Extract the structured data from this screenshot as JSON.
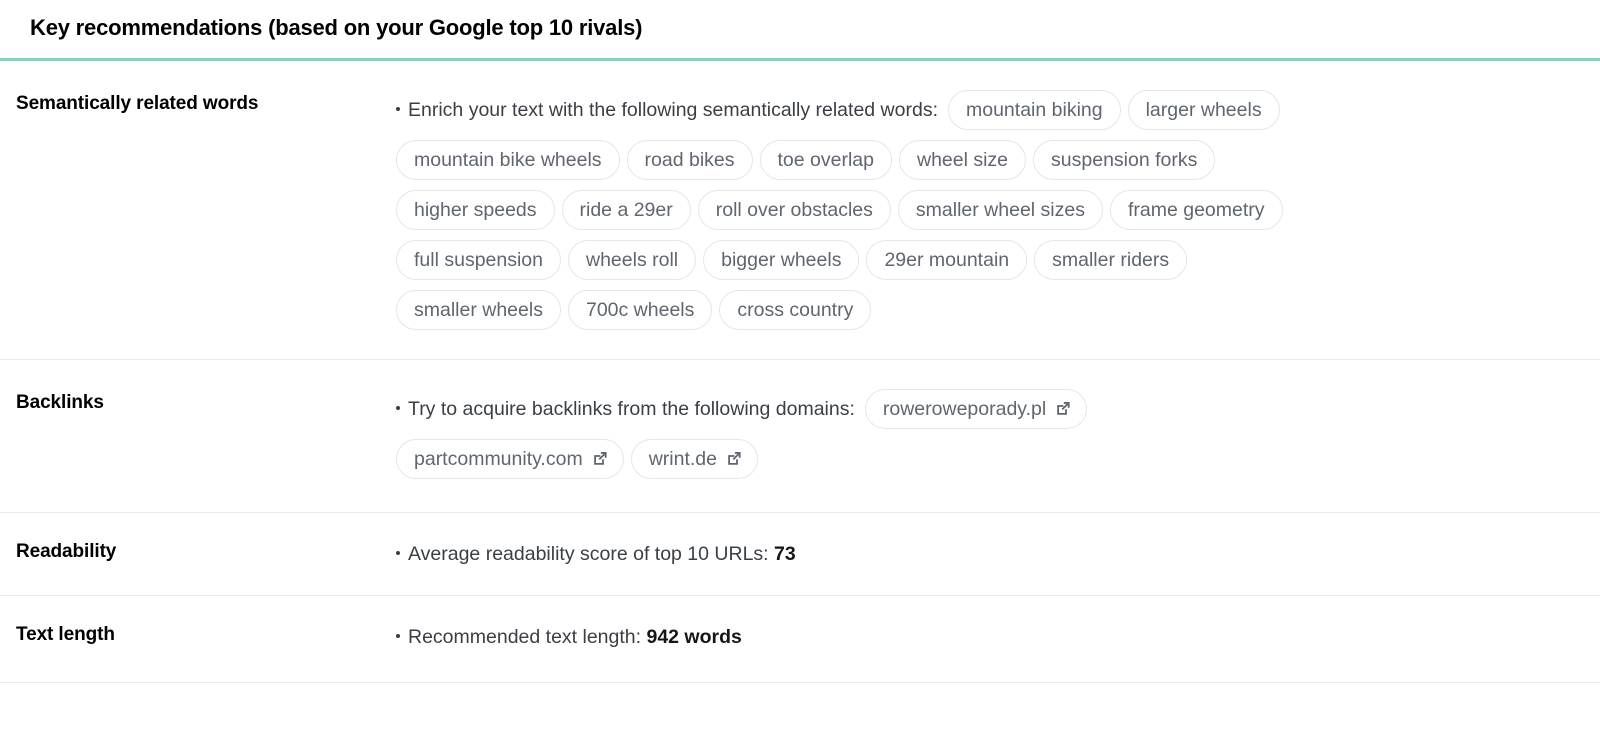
{
  "header": {
    "title": "Key recommendations (based on your Google top 10 rivals)",
    "accent_color": "#7fd8b8",
    "divider_color": "#e8eaed"
  },
  "sections": {
    "semantic": {
      "label": "Semantically related words",
      "lead": "Enrich your text with the following semantically related words:",
      "pills": [
        "mountain biking",
        "larger wheels",
        "mountain bike wheels",
        "road bikes",
        "toe overlap",
        "wheel size",
        "suspension forks",
        "higher speeds",
        "ride a 29er",
        "roll over obstacles",
        "smaller wheel sizes",
        "frame geometry",
        "full suspension",
        "wheels roll",
        "bigger wheels",
        "29er mountain",
        "smaller riders",
        "smaller wheels",
        "700c wheels",
        "cross country"
      ]
    },
    "backlinks": {
      "label": "Backlinks",
      "lead": "Try to acquire backlinks from the following domains:",
      "domains": [
        "roweroweporady.pl",
        "partcommunity.com",
        "wrint.de"
      ],
      "icon": "external-link-icon"
    },
    "readability": {
      "label": "Readability",
      "text": "Average readability score of top 10 URLs:",
      "value": "73"
    },
    "text_length": {
      "label": "Text length",
      "text": "Recommended text length:",
      "value": "942 words"
    }
  }
}
